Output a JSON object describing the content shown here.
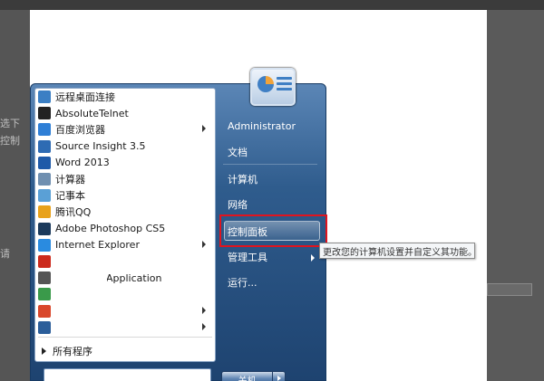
{
  "background": {
    "fragments": [
      "选下",
      "控制",
      "请"
    ]
  },
  "start_menu": {
    "programs": [
      {
        "label": "远程桌面连接",
        "icon": "remote-desktop-icon",
        "color": "#3b7fc4",
        "submenu": false
      },
      {
        "label": "AbsoluteTelnet",
        "icon": "telnet-icon",
        "color": "#222222",
        "submenu": false
      },
      {
        "label": "百度浏览器",
        "icon": "baidu-browser-icon",
        "color": "#2f7fd6",
        "submenu": true
      },
      {
        "label": "Source Insight 3.5",
        "icon": "source-insight-icon",
        "color": "#2e6bb3",
        "submenu": false
      },
      {
        "label": "Word 2013",
        "icon": "word-icon",
        "color": "#1f5aa8",
        "submenu": false
      },
      {
        "label": "计算器",
        "icon": "calculator-icon",
        "color": "#6f8fb0",
        "submenu": false
      },
      {
        "label": "记事本",
        "icon": "notepad-icon",
        "color": "#5aa0d6",
        "submenu": false
      },
      {
        "label": "腾讯QQ",
        "icon": "qq-icon",
        "color": "#e8a21b",
        "submenu": false
      },
      {
        "label": "Adobe Photoshop CS5",
        "icon": "photoshop-icon",
        "color": "#1b3a5c",
        "submenu": false
      },
      {
        "label": "Internet Explorer",
        "icon": "internet-explorer-icon",
        "color": "#2a8be0",
        "submenu": true
      },
      {
        "label": "",
        "icon": "app-icon",
        "color": "#cc2a1c",
        "submenu": false
      },
      {
        "label": "Application",
        "icon": "securecrt-icon",
        "color": "#555555",
        "submenu": false
      },
      {
        "label": "",
        "icon": "shield-app-icon",
        "color": "#3a9a4a",
        "submenu": false
      },
      {
        "label": "",
        "icon": "chrome-icon",
        "color": "#d9472b",
        "submenu": true
      },
      {
        "label": "",
        "icon": "virtualbox-icon",
        "color": "#2b5e9a",
        "submenu": true
      }
    ],
    "all_programs": "所有程序",
    "search_placeholder": "",
    "right_items": {
      "user": "Administrator",
      "documents": "文档",
      "computer": "计算机",
      "network": "网络",
      "control_panel": "控制面板",
      "admin_tools": "管理工具",
      "run": "运行..."
    },
    "tooltip": "更改您的计算机设置并自定义其功能。",
    "shutdown": "关机"
  }
}
